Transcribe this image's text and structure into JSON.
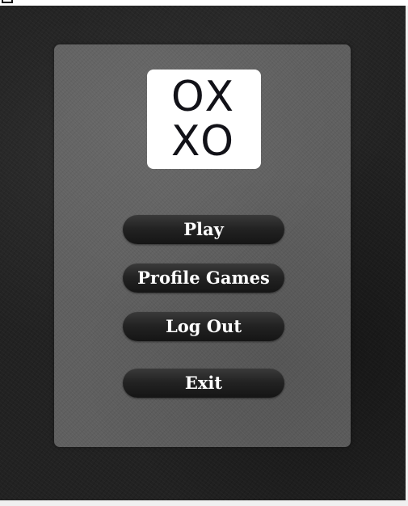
{
  "logo": {
    "line1": "OX",
    "line2": "XO"
  },
  "menu": {
    "play": "Play",
    "profile_games": "Profile Games",
    "log_out": "Log Out",
    "exit": "Exit"
  },
  "colors": {
    "backdrop": "#222222",
    "panel": "#5f5f5f",
    "button": "#1e1e1e",
    "button_text": "#ffffff",
    "logo_bg": "#ffffff",
    "logo_text": "#121218"
  }
}
